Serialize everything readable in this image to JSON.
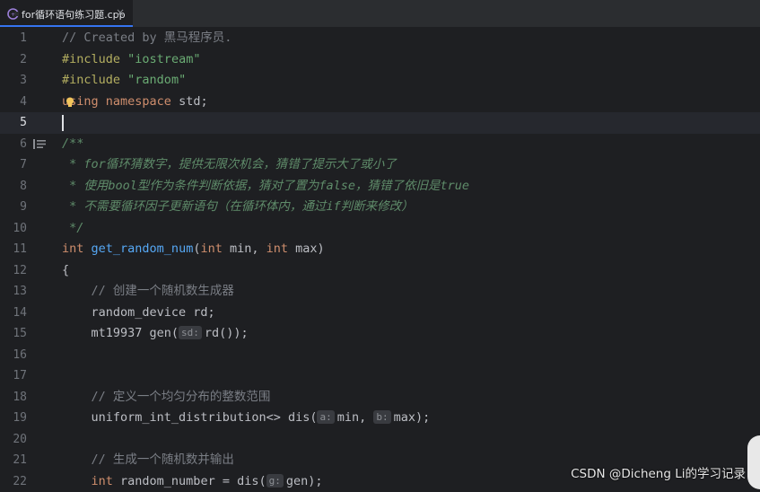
{
  "tab": {
    "title": "for循环语句练习题.cpp",
    "close": "×"
  },
  "editor": {
    "current_line": 5,
    "lines": [
      {
        "n": "1"
      },
      {
        "n": "2"
      },
      {
        "n": "3"
      },
      {
        "n": "4"
      },
      {
        "n": "5"
      },
      {
        "n": "6"
      },
      {
        "n": "7"
      },
      {
        "n": "8"
      },
      {
        "n": "9"
      },
      {
        "n": "10"
      },
      {
        "n": "11"
      },
      {
        "n": "12"
      },
      {
        "n": "13"
      },
      {
        "n": "14"
      },
      {
        "n": "15"
      },
      {
        "n": "16"
      },
      {
        "n": "17"
      },
      {
        "n": "18"
      },
      {
        "n": "19"
      },
      {
        "n": "20"
      },
      {
        "n": "21"
      },
      {
        "n": "22"
      }
    ],
    "code": {
      "l1": "// Created by 黑马程序员.",
      "l2_kw": "#include",
      "l2_str": "\"iostream\"",
      "l3_kw": "#include",
      "l3_str": "\"random\"",
      "l4_a": "using",
      "l4_b": "namespace",
      "l4_c": " std;",
      "l6": "/**",
      "l7": " * for循环猜数字，提供无限次机会，猜错了提示大了或小了",
      "l8": " * 使用bool型作为条件判断依据，猜对了置为false，猜错了依旧是true",
      "l9": " * 不需要循环因子更新语句（在循环体内，通过if判断来修改）",
      "l10": " */",
      "l11_kw1": "int",
      "l11_fn": "get_random_num",
      "l11_p1": "(",
      "l11_kw2": "int",
      "l11_p2": " min, ",
      "l11_kw3": "int",
      "l11_p3": " max)",
      "l12": "{",
      "l13": "    // 创建一个随机数生成器",
      "l14": "    random_device rd;",
      "l15_a": "    mt19937 gen(",
      "l15_hint": "sd:",
      "l15_b": "rd());",
      "l18": "    // 定义一个均匀分布的整数范围",
      "l19_a": "    uniform_int_distribution<> dis(",
      "l19_hint1": "a:",
      "l19_b": "min, ",
      "l19_hint2": "b:",
      "l19_c": "max);",
      "l21": "    // 生成一个随机数并输出",
      "l22_kw": "    int",
      "l22_a": " random_number = dis(",
      "l22_hint": "g:",
      "l22_b": "gen);"
    }
  },
  "watermark": "CSDN @Dicheng Li的学习记录"
}
